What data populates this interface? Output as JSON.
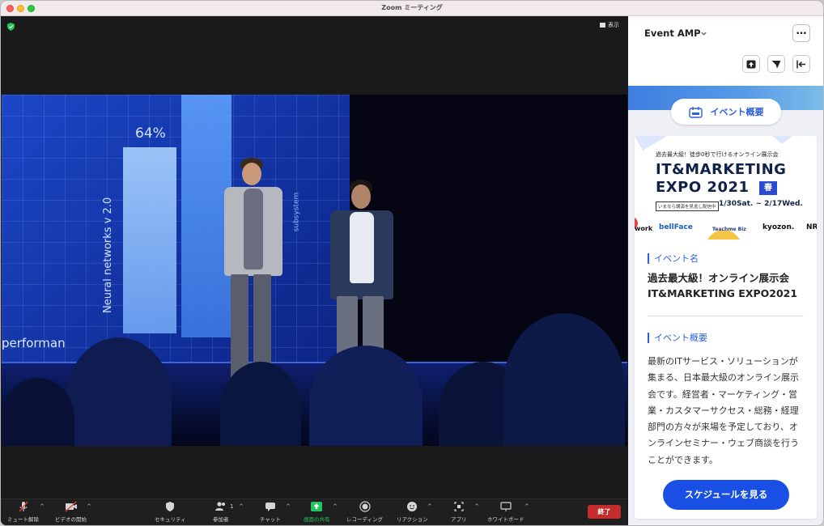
{
  "window": {
    "title": "Zoom ミーティング"
  },
  "video": {
    "view_label": "表示",
    "slide": {
      "percent": "64%",
      "vertical_text": "Neural networks v 2.0",
      "side_text": "subsystem",
      "bottom_text": "performan"
    }
  },
  "toolbar": {
    "items": [
      {
        "label": "ミュート解除",
        "icon": "mic-muted-icon"
      },
      {
        "label": "ビデオの開始",
        "icon": "video-off-icon"
      },
      {
        "label": "セキュリティ",
        "icon": "security-shield-icon"
      },
      {
        "label": "参加者",
        "icon": "participants-icon",
        "count": "1"
      },
      {
        "label": "チャット",
        "icon": "chat-icon"
      },
      {
        "label": "画面の共有",
        "icon": "share-screen-icon"
      },
      {
        "label": "レコーディング",
        "icon": "record-icon"
      },
      {
        "label": "リアクション",
        "icon": "reaction-icon"
      },
      {
        "label": "アプリ",
        "icon": "apps-icon"
      },
      {
        "label": "ホワイトボード",
        "icon": "whiteboard-icon"
      }
    ],
    "end_label": "終了",
    "share_color": "#22c55e",
    "end_color": "#c42d2a"
  },
  "sidebar": {
    "title": "Event AMP",
    "more_label": "…",
    "section_pill": "イベント概要",
    "banner": {
      "subtitle": "過去最大級！徒歩0秒で行けるオンライン展示会",
      "title_line1": "IT&MARKETING",
      "title_line2": "EXPO 2021",
      "season": "春",
      "note": "いまなら講演を見逃し配信中",
      "dates": "1/30Sat. ~ 2/17Wed.",
      "logos": [
        "work",
        "bellFace",
        "Teachme Biz",
        "kyozon.",
        "NR"
      ]
    },
    "event_name_label": "イベント名",
    "event_name": "過去最大級！オンライン展示会 IT&MARKETING EXPO2021",
    "overview_label": "イベント概要",
    "overview": "最新のITサービス・ソリューションが集まる、日本最大級のオンライン展示会です。経営者・マーケティング・営業・カスタマーサクセス・総務・経理部門の方々が来場を予定しており、オンラインセミナー・ウェブ商談を行うことができます。",
    "schedule_button": "スケジュールを見る",
    "accent_color": "#2b5fe2"
  }
}
